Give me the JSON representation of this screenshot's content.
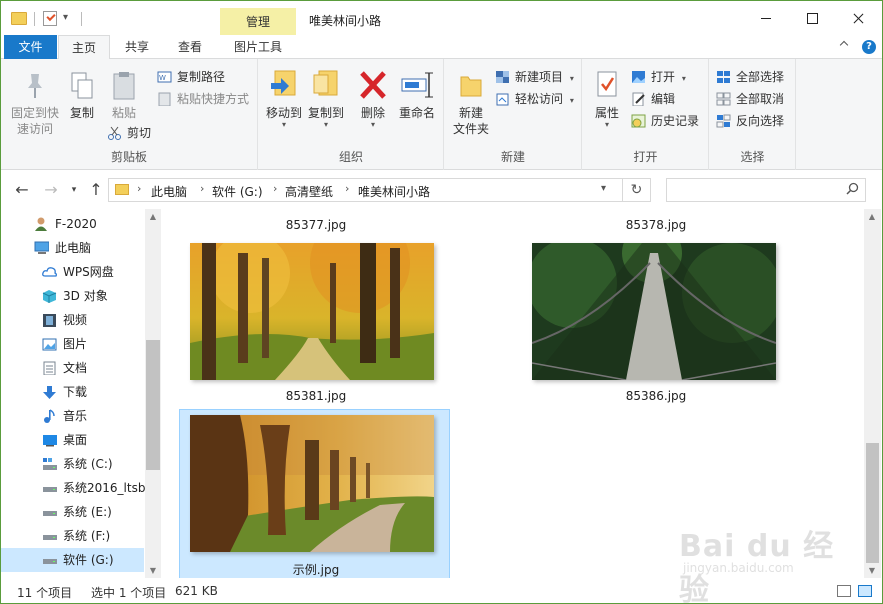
{
  "window": {
    "title": "唯美林间小路",
    "context_tab_label": "管理"
  },
  "tabs": [
    "文件",
    "主页",
    "共享",
    "查看",
    "图片工具"
  ],
  "help_label": "?",
  "ribbon": {
    "clipboard": {
      "pin_label": "固定到快\n速访问",
      "copy_label": "复制",
      "paste_label": "粘贴",
      "copy_path_label": "复制路径",
      "paste_shortcut_label": "粘贴快捷方式",
      "cut_label": "剪切",
      "group_label": "剪贴板"
    },
    "organize": {
      "move_to_label": "移动到",
      "copy_to_label": "复制到",
      "delete_label": "删除",
      "rename_label": "重命名",
      "group_label": "组织"
    },
    "new": {
      "new_folder_label": "新建\n文件夹",
      "new_item_label": "新建项目",
      "easy_access_label": "轻松访问",
      "group_label": "新建"
    },
    "open": {
      "properties_label": "属性",
      "open_label": "打开",
      "edit_label": "编辑",
      "history_label": "历史记录",
      "group_label": "打开"
    },
    "select": {
      "select_all_label": "全部选择",
      "select_none_label": "全部取消",
      "invert_label": "反向选择",
      "group_label": "选择"
    }
  },
  "address": {
    "crumbs": [
      "此电脑",
      "软件 (G:)",
      "高清壁纸",
      "唯美林间小路"
    ],
    "search_placeholder": ""
  },
  "nav": {
    "items": [
      {
        "label": "F-2020",
        "icon": "user-icon"
      },
      {
        "label": "此电脑",
        "icon": "computer-icon"
      },
      {
        "label": "WPS网盘",
        "icon": "cloud-icon"
      },
      {
        "label": "3D 对象",
        "icon": "cube-icon"
      },
      {
        "label": "视频",
        "icon": "video-icon"
      },
      {
        "label": "图片",
        "icon": "picture-icon"
      },
      {
        "label": "文档",
        "icon": "document-icon"
      },
      {
        "label": "下载",
        "icon": "download-icon"
      },
      {
        "label": "音乐",
        "icon": "music-icon"
      },
      {
        "label": "桌面",
        "icon": "desktop-icon"
      },
      {
        "label": "系统 (C:)",
        "icon": "drive-icon"
      },
      {
        "label": "系统2016_ltsb",
        "icon": "drive-icon"
      },
      {
        "label": "系统 (E:)",
        "icon": "drive-icon"
      },
      {
        "label": "系统 (F:)",
        "icon": "drive-icon"
      },
      {
        "label": "软件 (G:)",
        "icon": "drive-icon"
      }
    ]
  },
  "files": [
    {
      "name": "85377.jpg"
    },
    {
      "name": "85378.jpg"
    },
    {
      "name": "85381.jpg"
    },
    {
      "name": "85386.jpg"
    },
    {
      "name": "示例.jpg",
      "selected": true
    }
  ],
  "status": {
    "count": "11 个项目",
    "selected": "选中 1 个项目",
    "size": "621 KB"
  },
  "watermark": {
    "text": "Bai du 经验",
    "url": "jingyan.baidu.com"
  },
  "colors": {
    "accent": "#1979ca",
    "context_tab": "#f5f0a6",
    "selection": "#cce8ff"
  }
}
